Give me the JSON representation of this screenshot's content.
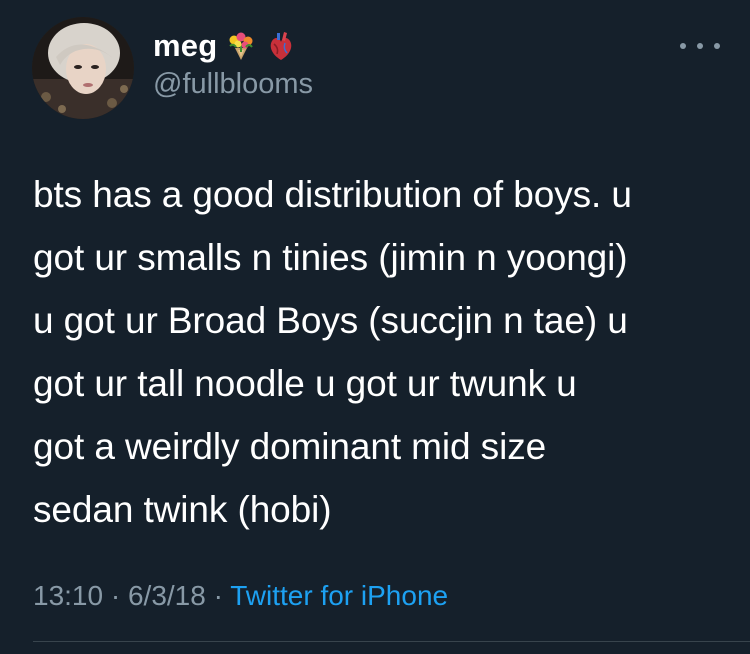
{
  "user": {
    "display_name": "meg",
    "handle": "@fullblooms",
    "emojis": [
      "bouquet-emoji",
      "anatomical-heart-emoji"
    ]
  },
  "tweet": {
    "lines": [
      "bts has a good distribution of boys. u",
      "got ur smalls n tinies (jimin n yoongi)",
      "u got ur Broad Boys (succjin n tae) u",
      "got ur tall noodle u got ur twunk u",
      "got a weirdly dominant mid size",
      "sedan twink (hobi)"
    ]
  },
  "meta": {
    "time": "13:10",
    "separator": " · ",
    "date": "6/3/18",
    "source": "Twitter for iPhone"
  },
  "colors": {
    "background": "#15202b",
    "secondary_text": "#8899a6",
    "link": "#1da1f2"
  },
  "icons": {
    "more": "more-dots-icon"
  }
}
